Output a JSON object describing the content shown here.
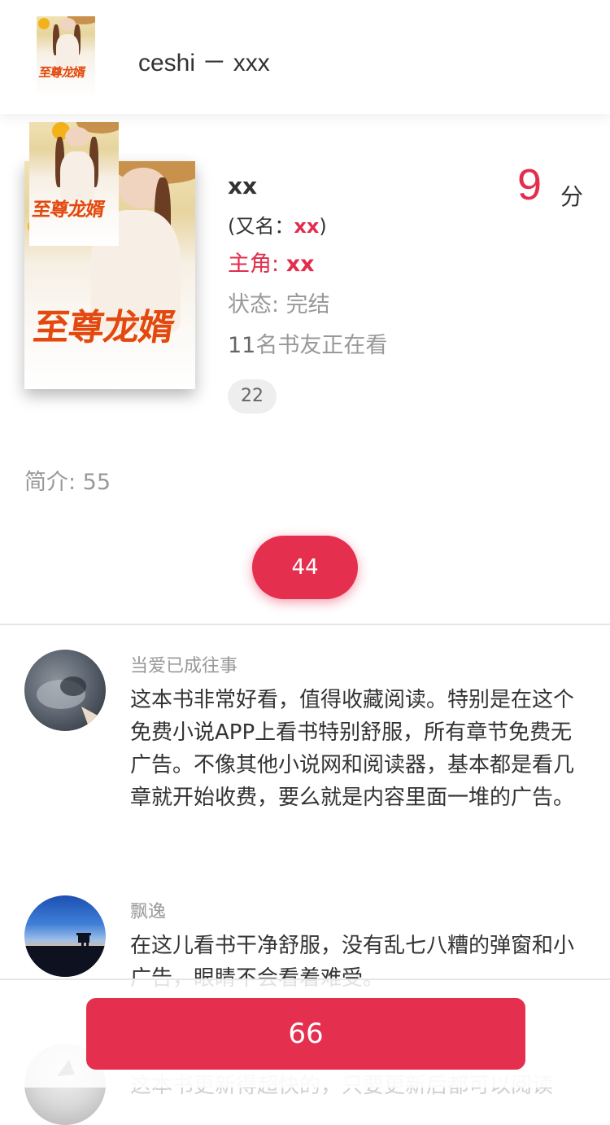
{
  "header": {
    "title": "ceshi － xxx",
    "cover_title": "至尊龙婿"
  },
  "book": {
    "name": "xx",
    "alias_prefix": "(又名：",
    "alias_value": "xx",
    "alias_suffix": ")",
    "hero_label": "主角: ",
    "hero_value": "xx",
    "status": "状态: 完结",
    "readers_num": "11",
    "readers_suffix": "名书友正在看",
    "tag": "22",
    "score": "9",
    "score_unit": "分",
    "cover_title": "至尊龙婿"
  },
  "intro": "简介: 55",
  "action_button": "44",
  "comments": [
    {
      "user": "当爱已成往事",
      "text": "这本书非常好看，值得收藏阅读。特别是在这个免费小说APP上看书特别舒服，所有章节免费无广告。不像其他小说网和阅读器，基本都是看几章就开始收费，要么就是内容里面一堆的广告。"
    },
    {
      "user": "飘逸",
      "text": "在这儿看书干净舒服，没有乱七八糟的弹窗和小广告，眼睛不会看着难受。"
    },
    {
      "user": "",
      "text": "这本书更新得超快的，只要更新后都可以阅读"
    }
  ],
  "bottom_button": "66",
  "colors": {
    "accent": "#e52f4f",
    "muted": "#999999",
    "text": "#333333"
  }
}
